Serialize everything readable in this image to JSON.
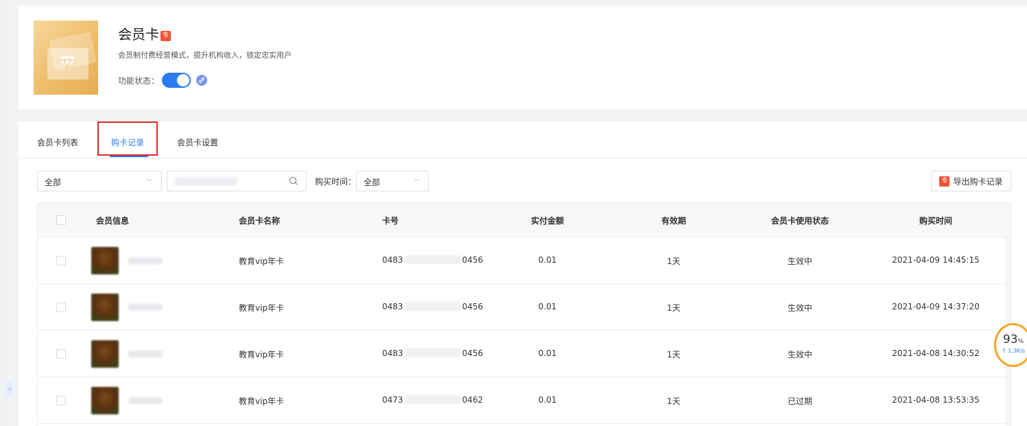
{
  "header": {
    "title": "会员卡",
    "title_badge": "专",
    "subtitle": "会员制付费经营模式，提升机构收入，锁定忠实用户",
    "status_label": "功能状态："
  },
  "tabs": [
    {
      "label": "会员卡列表",
      "active": false
    },
    {
      "label": "购卡记录",
      "active": true
    },
    {
      "label": "会员卡设置",
      "active": false
    }
  ],
  "filters": {
    "type_select": "全部",
    "time_label": "购买时间：",
    "time_select": "全部",
    "export_badge": "专",
    "export_label": "导出购卡记录"
  },
  "table": {
    "columns": [
      "会员信息",
      "会员卡名称",
      "卡号",
      "实付金额",
      "有效期",
      "会员卡使用状态",
      "购买时间"
    ],
    "rows": [
      {
        "card_name": "教育vip年卡",
        "card_prefix": "0483",
        "card_suffix": "0456",
        "amount": "0.01",
        "validity": "1天",
        "status": "生效中",
        "purchase_time": "2021-04-09 14:45:15"
      },
      {
        "card_name": "教育vip年卡",
        "card_prefix": "0483",
        "card_suffix": "0456",
        "amount": "0.01",
        "validity": "1天",
        "status": "生效中",
        "purchase_time": "2021-04-09 14:37:20"
      },
      {
        "card_name": "教育vip年卡",
        "card_prefix": "0483",
        "card_suffix": "0456",
        "amount": "0.01",
        "validity": "1天",
        "status": "生效中",
        "purchase_time": "2021-04-08 14:30:52"
      },
      {
        "card_name": "教育vip年卡",
        "card_prefix": "0473",
        "card_suffix": "0462",
        "amount": "0.01",
        "validity": "1天",
        "status": "已过期",
        "purchase_time": "2021-04-08 13:53:35"
      }
    ]
  },
  "widget": {
    "percent": "93",
    "percent_unit": "%",
    "rate": "↑ 1.3K/s"
  },
  "colors": {
    "accent": "#2a7bf2",
    "badge": "#f25236",
    "highlight": "#e0262b"
  }
}
